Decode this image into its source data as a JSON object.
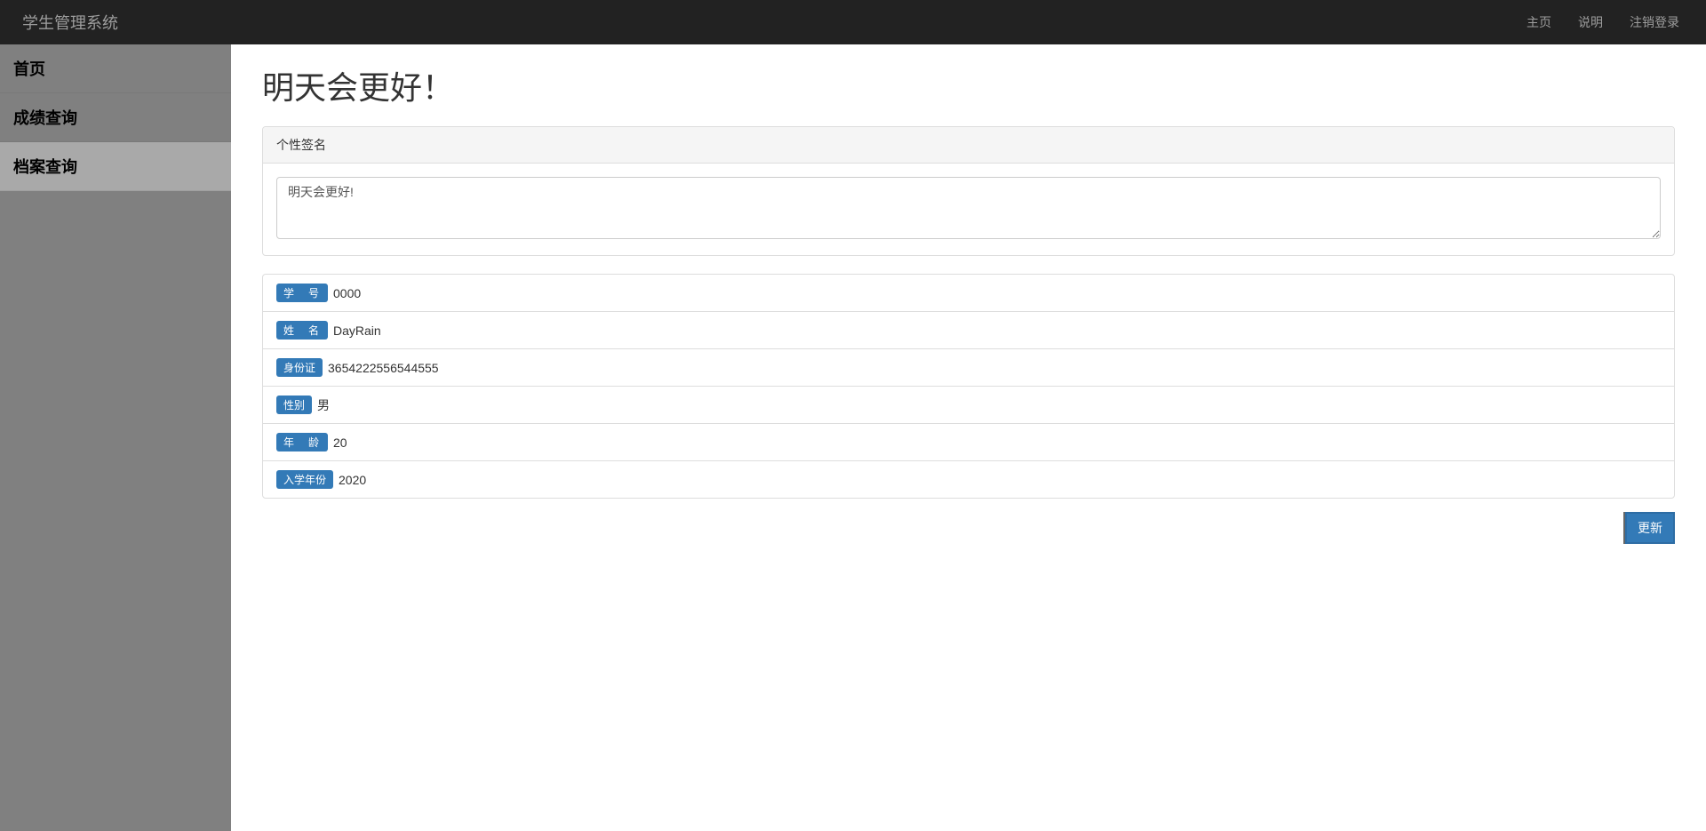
{
  "navbar": {
    "brand": "学生管理系统",
    "links": [
      {
        "label": "主页"
      },
      {
        "label": "说明"
      },
      {
        "label": "注销登录"
      }
    ]
  },
  "sidebar": {
    "items": [
      {
        "label": "首页",
        "active": false
      },
      {
        "label": "成绩查询",
        "active": false
      },
      {
        "label": "档案查询",
        "active": true
      }
    ]
  },
  "main": {
    "title": "明天会更好！",
    "panel_heading": "个性签名",
    "signature_value": "明天会更好!",
    "fields": [
      {
        "label": "学　号",
        "value": "0000"
      },
      {
        "label": "姓　名",
        "value": "DayRain"
      },
      {
        "label": "身份证",
        "value": "3654222556544555"
      },
      {
        "label": "性别",
        "value": "男"
      },
      {
        "label": "年　龄",
        "value": "20"
      },
      {
        "label": "入学年份",
        "value": "2020"
      }
    ],
    "update_button": "更新"
  }
}
